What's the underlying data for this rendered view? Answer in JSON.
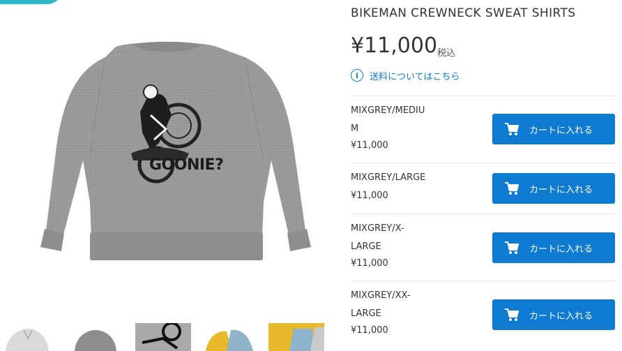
{
  "product": {
    "title": "BIKEMAN CREWNECK SWEAT SHIRTS",
    "price": "¥11,000",
    "tax_label": "税込",
    "shipping_link": "送料についてはこちら",
    "image_print_text": "GOONIE?"
  },
  "variants": [
    {
      "name_line1": "MIXGREY/MEDIU",
      "name_line2": "M",
      "price": "¥11,000",
      "button": "カートに入れる"
    },
    {
      "name_line1": "MIXGREY/LARGE",
      "name_line2": "",
      "price": "¥11,000",
      "button": "カートに入れる"
    },
    {
      "name_line1": "MIXGREY/X-",
      "name_line2": "LARGE",
      "price": "¥11,000",
      "button": "カートに入れる"
    },
    {
      "name_line1": "MIXGREY/XX-",
      "name_line2": "LARGE",
      "price": "¥11,000",
      "button": "カートに入れる"
    }
  ],
  "colors": {
    "accent": "#0f7bd0",
    "sweat_grey": "#9a9a9a",
    "thumb_yellow": "#e8b92a",
    "top_accent": "#2fb8c8"
  },
  "icons": [
    "info-icon",
    "cart-icon"
  ]
}
